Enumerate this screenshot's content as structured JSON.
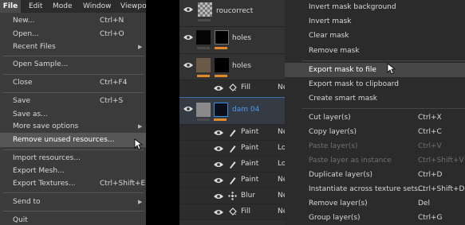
{
  "file_menu": {
    "menubar": [
      "File",
      "Edit",
      "Mode",
      "Window",
      "Viewpo"
    ],
    "items": [
      {
        "label": "New...",
        "shortcut": "Ctrl+N"
      },
      {
        "label": "Open...",
        "shortcut": "Ctrl+O"
      },
      {
        "label": "Recent Files",
        "shortcut": "",
        "submenu": "▶"
      },
      {
        "label": "Open Sample...",
        "shortcut": ""
      },
      {
        "label": "Close",
        "shortcut": "Ctrl+F4"
      },
      {
        "label": "Save",
        "shortcut": "Ctrl+S"
      },
      {
        "label": "Save as...",
        "shortcut": ""
      },
      {
        "label": "More save options",
        "shortcut": "",
        "submenu": "▶"
      },
      {
        "label": "Remove unused resources...",
        "shortcut": ""
      },
      {
        "label": "Import resources...",
        "shortcut": ""
      },
      {
        "label": "Export Mesh...",
        "shortcut": ""
      },
      {
        "label": "Export Textures...",
        "shortcut": "Ctrl+Shift+E"
      },
      {
        "label": "Send to",
        "shortcut": "",
        "submenu": "▶"
      },
      {
        "label": "Quit",
        "shortcut": ""
      }
    ]
  },
  "layers": {
    "top": [
      {
        "name": "roucorrect"
      },
      {
        "name": "holes"
      },
      {
        "name": "holes"
      }
    ],
    "fill_sub": {
      "name": "Fill",
      "extra": "Ne"
    },
    "group": {
      "name": "dam 04",
      "color": "#3a8fe0"
    },
    "effects": [
      {
        "icon": "brush-icon",
        "name": "Paint",
        "extra": "Ne"
      },
      {
        "icon": "brush-icon",
        "name": "Paint",
        "extra": "Lo"
      },
      {
        "icon": "brush-icon",
        "name": "Paint",
        "extra": "Lo"
      },
      {
        "icon": "brush-icon",
        "name": "Paint",
        "extra": "Ne"
      },
      {
        "icon": "blur-icon",
        "name": "Blur",
        "extra": "Ne"
      },
      {
        "icon": "fill-icon",
        "name": "Fill",
        "extra": "Ne"
      }
    ]
  },
  "context_menu": {
    "items": [
      {
        "label": "Invert mask background",
        "shortcut": ""
      },
      {
        "label": "Invert mask",
        "shortcut": ""
      },
      {
        "label": "Clear mask",
        "shortcut": ""
      },
      {
        "label": "Remove mask",
        "shortcut": ""
      },
      {
        "label": "Export mask to file",
        "shortcut": ""
      },
      {
        "label": "Export mask to clipboard",
        "shortcut": ""
      },
      {
        "label": "Create smart mask",
        "shortcut": ""
      },
      {
        "label": "Cut layer(s)",
        "shortcut": "Ctrl+X"
      },
      {
        "label": "Copy layer(s)",
        "shortcut": "Ctrl+C"
      },
      {
        "label": "Paste layer(s)",
        "shortcut": "Ctrl+V"
      },
      {
        "label": "Paste layer as instance",
        "shortcut": "Ctrl+Shift+V"
      },
      {
        "label": "Duplicate layer(s)",
        "shortcut": "Ctrl+D"
      },
      {
        "label": "Instantiate across texture sets...",
        "shortcut": "Ctrl+Shift+D"
      },
      {
        "label": "Remove layer(s)",
        "shortcut": "Del"
      },
      {
        "label": "Group layer(s)",
        "shortcut": "Ctrl+G"
      }
    ]
  },
  "colors": {
    "accent_orange": "#e08a2a",
    "selection_blue": "#3a8fe0"
  }
}
